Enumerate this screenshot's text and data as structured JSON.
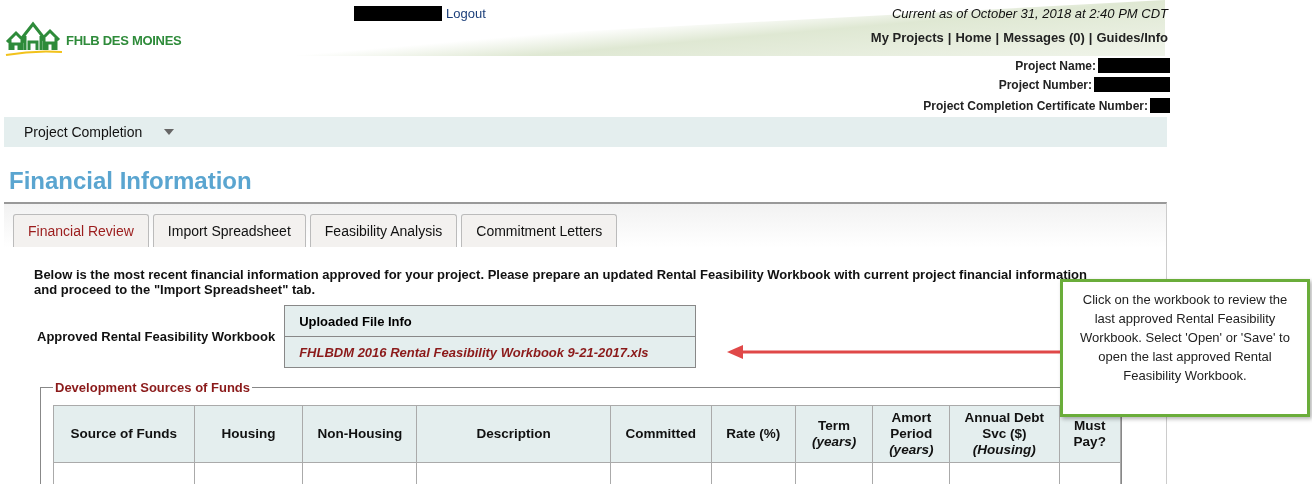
{
  "header": {
    "logo_text": "FHLB DES MOINES",
    "logout": "Logout",
    "timestamp": "Current as of October 31, 2018 at 2:40 PM CDT",
    "nav_separator": "|",
    "nav_links": [
      {
        "label": "My Projects"
      },
      {
        "label": "Home"
      },
      {
        "label": "Messages (0)"
      },
      {
        "label": "Guides/Info"
      }
    ],
    "project_fields": [
      {
        "label": "Project Name:"
      },
      {
        "label": "Project Number:"
      },
      {
        "label": "Project Completion Certificate Number:"
      }
    ]
  },
  "menu": {
    "label": "Project Completion"
  },
  "page_title": "Financial Information",
  "tabs": [
    {
      "label": "Financial Review",
      "selected": true
    },
    {
      "label": "Import Spreadsheet",
      "selected": false
    },
    {
      "label": "Feasibility Analysis",
      "selected": false
    },
    {
      "label": "Commitment Letters",
      "selected": false
    }
  ],
  "intro": "Below is the most recent financial information approved for your project. Please prepare an updated Rental Feasibility Workbook with current project financial information and proceed to the \"Import Spreadsheet\" tab.",
  "workbook": {
    "label": "Approved Rental Feasibility Workbook",
    "column": "Uploaded File Info",
    "file": "FHLBDM 2016 Rental Feasibility Workbook 9-21-2017.xls"
  },
  "sources": {
    "legend": "Development Sources of Funds",
    "columns": [
      "Source of Funds",
      "Housing",
      "Non-Housing",
      "Description",
      "Committed",
      "Rate (%)",
      "Term *(years)*",
      "Amort Period *(years)*",
      "Annual Debt Svc ($) *(Housing)*",
      "Must Pay?"
    ]
  },
  "callout": "Click on the workbook to review the last approved Rental Feasibility Workbook. Select 'Open' or 'Save' to open the last approved Rental Feasibility Workbook."
}
